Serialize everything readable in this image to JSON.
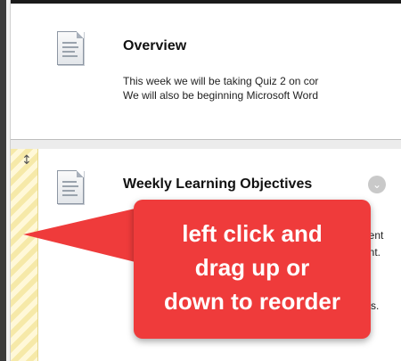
{
  "overview": {
    "title": "Overview",
    "line1": "This week we will be taking Quiz 2 on cor",
    "line2": " We will also be beginning Microsoft Word"
  },
  "objectives": {
    "title": "Weekly Learning Objectives",
    "partial_1": "dent",
    "partial_2": "ent.",
    "partial_3": "s."
  },
  "drag_handle": {
    "icon": "vertical-resize-arrow-icon",
    "glyph": "↕"
  },
  "menu": {
    "icon": "chevron-down-icon",
    "glyph": "⌄"
  },
  "callout": {
    "line1": "left click and",
    "line2": "drag up or",
    "line3": "down to reorder",
    "color": "#ef3b3b"
  },
  "colors": {
    "handle_stripe_a": "#f6e9a8",
    "handle_stripe_b": "#fff8d8"
  }
}
